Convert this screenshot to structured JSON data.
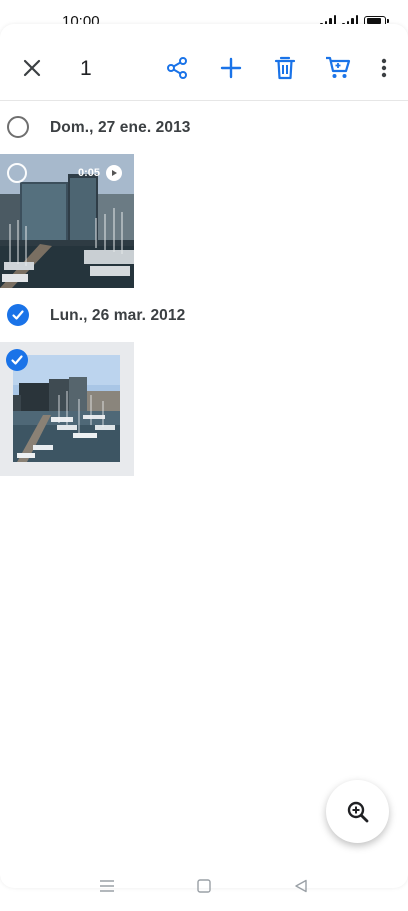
{
  "status_bar": {
    "time": "10:00",
    "battery_level": 0.9
  },
  "toolbar": {
    "selected_count": "1",
    "icons": [
      "close-icon",
      "share-icon",
      "add-icon",
      "delete-icon",
      "cart-icon",
      "more-vert-icon"
    ],
    "accent_color": "#1a73e8"
  },
  "groups": [
    {
      "date": "Dom., 27 ene. 2013",
      "selected": false,
      "items": [
        {
          "type": "video",
          "duration": "0:05",
          "selected": false
        }
      ]
    },
    {
      "date": "Lun., 26 mar. 2012",
      "selected": true,
      "items": [
        {
          "type": "photo",
          "selected": true
        }
      ]
    }
  ],
  "fab": {
    "icon": "zoom-in-icon"
  },
  "nav_bar": {
    "icons": [
      "menu-icon",
      "home-icon",
      "back-icon"
    ]
  }
}
